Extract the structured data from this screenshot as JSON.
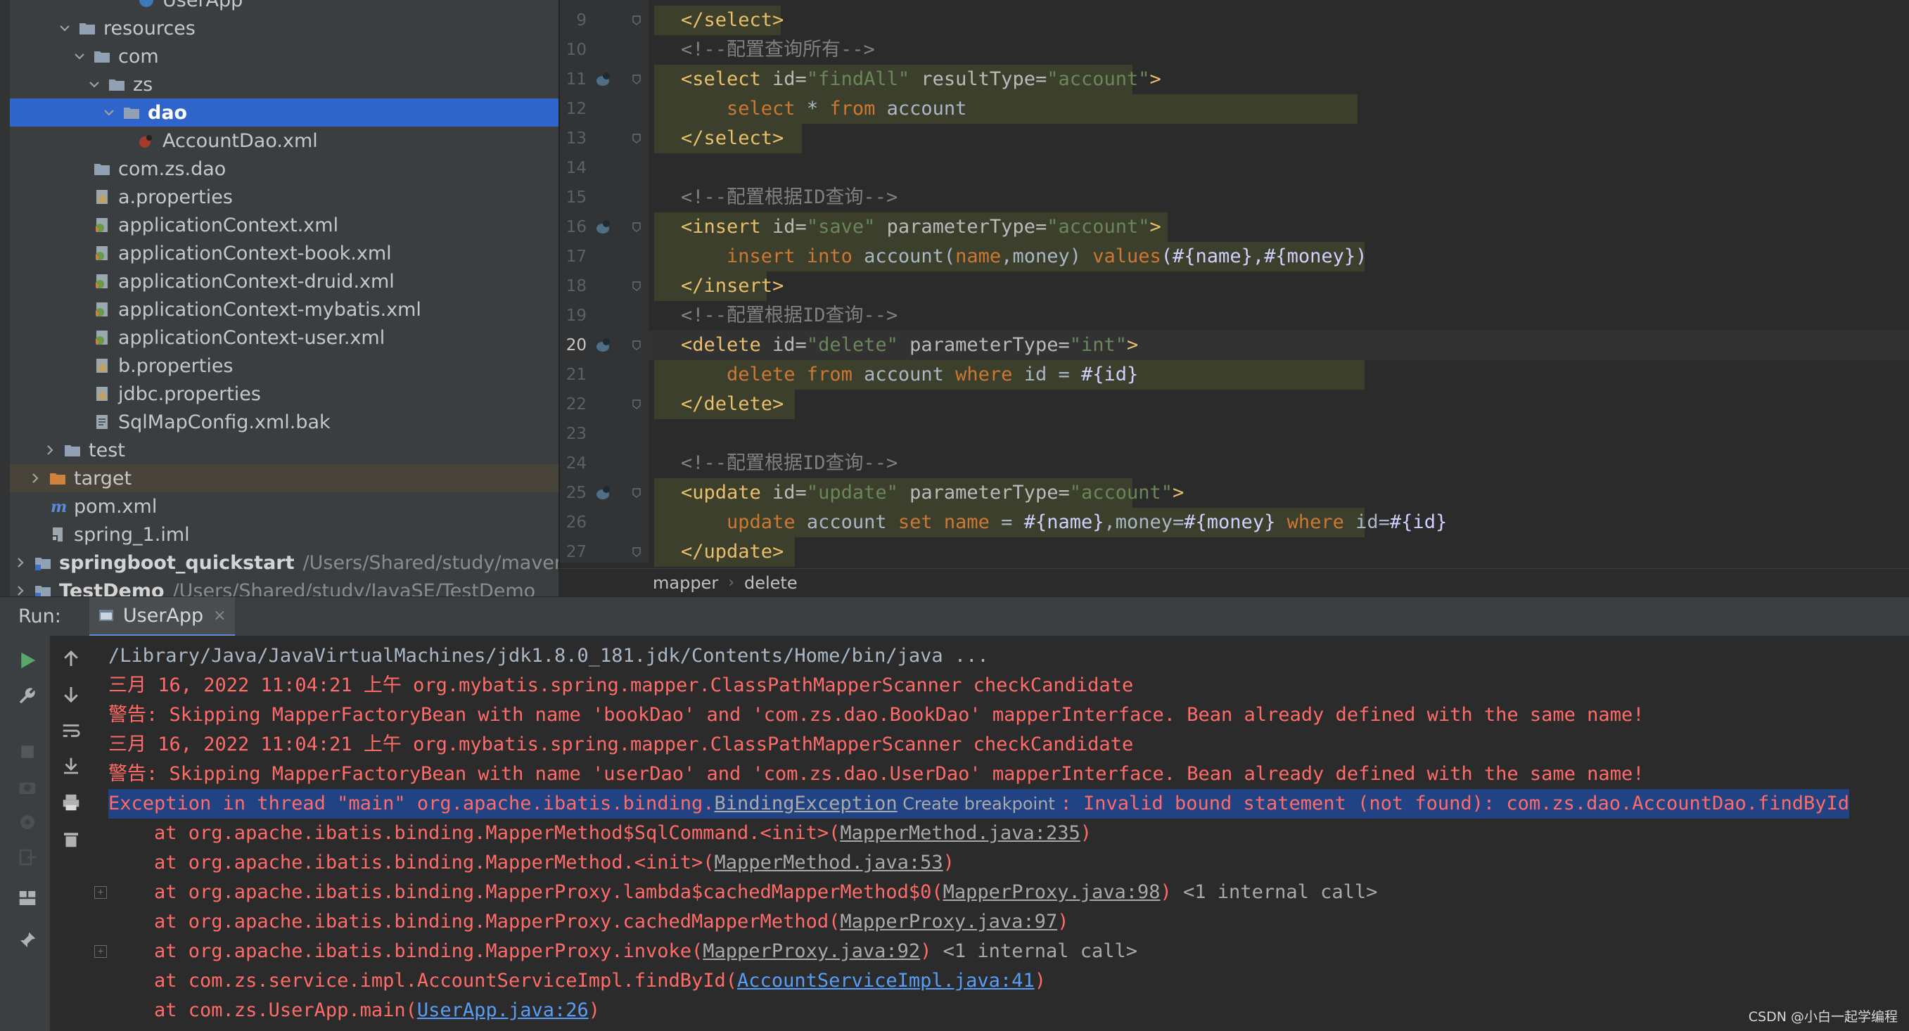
{
  "project_tree": [
    {
      "label": "UserApp",
      "icon": "run-config-icon",
      "level": 7,
      "kind": "partial"
    },
    {
      "label": "resources",
      "icon": "folder-icon",
      "level": 3,
      "expanded": true
    },
    {
      "label": "com",
      "icon": "folder-icon",
      "level": 4,
      "expanded": true
    },
    {
      "label": "zs",
      "icon": "folder-icon",
      "level": 5,
      "expanded": true
    },
    {
      "label": "dao",
      "icon": "folder-icon",
      "level": 6,
      "expanded": true,
      "selected": true
    },
    {
      "label": "AccountDao.xml",
      "icon": "mybatis-xml-icon",
      "level": 7
    },
    {
      "label": "com.zs.dao",
      "icon": "folder-icon",
      "level": 4
    },
    {
      "label": "a.properties",
      "icon": "properties-file-icon",
      "level": 4
    },
    {
      "label": "applicationContext.xml",
      "icon": "spring-xml-icon",
      "level": 4
    },
    {
      "label": "applicationContext-book.xml",
      "icon": "spring-xml-icon",
      "level": 4
    },
    {
      "label": "applicationContext-druid.xml",
      "icon": "spring-xml-icon",
      "level": 4
    },
    {
      "label": "applicationContext-mybatis.xml",
      "icon": "spring-xml-icon",
      "level": 4
    },
    {
      "label": "applicationContext-user.xml",
      "icon": "spring-xml-icon",
      "level": 4
    },
    {
      "label": "b.properties",
      "icon": "properties-file-icon",
      "level": 4
    },
    {
      "label": "jdbc.properties",
      "icon": "properties-file-icon",
      "level": 4
    },
    {
      "label": "SqlMapConfig.xml.bak",
      "icon": "text-file-icon",
      "level": 4
    },
    {
      "label": "test",
      "icon": "folder-icon",
      "level": 2,
      "collapsed": true
    },
    {
      "label": "target",
      "icon": "orange-folder-icon",
      "level": 1,
      "collapsed": true,
      "highlight": true
    },
    {
      "label": "pom.xml",
      "icon": "maven-icon",
      "level": 1
    },
    {
      "label": "spring_1.iml",
      "icon": "iml-file-icon",
      "level": 1
    },
    {
      "label": "springboot_quickstart",
      "path": "/Users/Shared/study/maven/spr",
      "icon": "module-icon",
      "level": 0,
      "collapsed": true,
      "bold": true
    },
    {
      "label": "TestDemo",
      "path": "/Users/Shared/study/JavaSE/TestDemo",
      "icon": "module-icon",
      "level": 0,
      "collapsed": true,
      "bold": true
    }
  ],
  "editor": {
    "line_numbers": [
      "9",
      "10",
      "11",
      "12",
      "13",
      "14",
      "15",
      "16",
      "17",
      "18",
      "19",
      "20",
      "21",
      "22",
      "23",
      "24",
      "25",
      "26",
      "27"
    ],
    "current_line": "20",
    "lines": [
      [
        {
          "t": "</select>",
          "c": "t-tag"
        }
      ],
      [
        {
          "t": "<!--配置查询所有-->",
          "c": "t-cmt"
        }
      ],
      [
        {
          "t": "<select ",
          "c": "t-tag"
        },
        {
          "t": "id=",
          "c": "t-attr"
        },
        {
          "t": "\"findAll\"",
          "c": "t-val"
        },
        {
          "t": " resultType=",
          "c": "t-attr"
        },
        {
          "t": "\"account\"",
          "c": "t-val"
        },
        {
          "t": ">",
          "c": "t-tag"
        }
      ],
      [
        {
          "t": "    select ",
          "c": "t-kw"
        },
        {
          "t": "* ",
          "c": "t-txt"
        },
        {
          "t": "from ",
          "c": "t-kw"
        },
        {
          "t": "account",
          "c": "t-txt"
        }
      ],
      [
        {
          "t": "</select>",
          "c": "t-tag"
        }
      ],
      [],
      [
        {
          "t": "<!--配置根据ID查询-->",
          "c": "t-cmt"
        }
      ],
      [
        {
          "t": "<insert ",
          "c": "t-tag"
        },
        {
          "t": "id=",
          "c": "t-attr"
        },
        {
          "t": "\"save\"",
          "c": "t-val"
        },
        {
          "t": " parameterType=",
          "c": "t-attr"
        },
        {
          "t": "\"account\"",
          "c": "t-val"
        },
        {
          "t": ">",
          "c": "t-tag"
        }
      ],
      [
        {
          "t": "    insert into ",
          "c": "t-kw"
        },
        {
          "t": "account(",
          "c": "t-txt"
        },
        {
          "t": "name",
          "c": "t-kw"
        },
        {
          "t": ",",
          "c": "t-txt"
        },
        {
          "t": "money",
          "c": "t-txt"
        },
        {
          "t": ") ",
          "c": "t-txt"
        },
        {
          "t": "values",
          "c": "t-kw"
        },
        {
          "t": "(#{name},#{money})",
          "c": "t-tpl"
        }
      ],
      [
        {
          "t": "</insert>",
          "c": "t-tag"
        }
      ],
      [
        {
          "t": "<!--配置根据ID查询-->",
          "c": "t-cmt"
        }
      ],
      [
        {
          "t": "<delete ",
          "c": "t-tag"
        },
        {
          "t": "id=",
          "c": "t-attr"
        },
        {
          "t": "\"delete\"",
          "c": "t-val"
        },
        {
          "t": " parameterType=",
          "c": "t-attr"
        },
        {
          "t": "\"int\"",
          "c": "t-val"
        },
        {
          "t": ">",
          "c": "t-tag"
        }
      ],
      [
        {
          "t": "    delete from ",
          "c": "t-kw"
        },
        {
          "t": "account ",
          "c": "t-txt"
        },
        {
          "t": "where ",
          "c": "t-kw"
        },
        {
          "t": "id = ",
          "c": "t-txt"
        },
        {
          "t": "#{id}",
          "c": "t-tpl"
        }
      ],
      [
        {
          "t": "</delete>",
          "c": "t-tag"
        }
      ],
      [],
      [
        {
          "t": "<!--配置根据ID查询-->",
          "c": "t-cmt"
        }
      ],
      [
        {
          "t": "<update ",
          "c": "t-tag"
        },
        {
          "t": "id=",
          "c": "t-attr"
        },
        {
          "t": "\"update\"",
          "c": "t-val"
        },
        {
          "t": " parameterType=",
          "c": "t-attr"
        },
        {
          "t": "\"account\"",
          "c": "t-val"
        },
        {
          "t": ">",
          "c": "t-tag"
        }
      ],
      [
        {
          "t": "    update ",
          "c": "t-kw"
        },
        {
          "t": "account ",
          "c": "t-txt"
        },
        {
          "t": "set ",
          "c": "t-kw"
        },
        {
          "t": "name ",
          "c": "t-kw"
        },
        {
          "t": "= ",
          "c": "t-txt"
        },
        {
          "t": "#{name}",
          "c": "t-tpl"
        },
        {
          "t": ",money=",
          "c": "t-txt"
        },
        {
          "t": "#{money} ",
          "c": "t-tpl"
        },
        {
          "t": "where ",
          "c": "t-kw"
        },
        {
          "t": "id=",
          "c": "t-txt"
        },
        {
          "t": "#{id}",
          "c": "t-tpl"
        }
      ],
      [
        {
          "t": "</update>",
          "c": "t-tag"
        }
      ]
    ],
    "breadcrumb": [
      "mapper",
      "delete"
    ]
  },
  "run": {
    "label": "Run:",
    "tab": "UserApp",
    "close": "×"
  },
  "console": {
    "lines": [
      {
        "kind": "gray",
        "parts": [
          {
            "t": "/Library/Java/JavaVirtualMachines/jdk1.8.0_181.jdk/Contents/Home/bin/java ..."
          }
        ]
      },
      {
        "kind": "err",
        "parts": [
          {
            "t": "三月 16, 2022 11:04:21 上午 org.mybatis.spring.mapper.ClassPathMapperScanner checkCandidate"
          }
        ]
      },
      {
        "kind": "err",
        "parts": [
          {
            "t": "警告: Skipping MapperFactoryBean with name 'bookDao' and 'com.zs.dao.BookDao' mapperInterface. Bean already defined with the same name!"
          }
        ]
      },
      {
        "kind": "err",
        "parts": [
          {
            "t": "三月 16, 2022 11:04:21 上午 org.mybatis.spring.mapper.ClassPathMapperScanner checkCandidate"
          }
        ]
      },
      {
        "kind": "err",
        "parts": [
          {
            "t": "警告: Skipping MapperFactoryBean with name 'userDao' and 'com.zs.dao.UserDao' mapperInterface. Bean already defined with the same name!"
          }
        ]
      },
      {
        "kind": "exc",
        "parts": [
          {
            "t": "Exception in thread \"main\" org.apache.ibatis.binding."
          },
          {
            "t": "BindingException",
            "c": "lk"
          },
          {
            "t": " Create breakpoint ",
            "c": "chip"
          },
          {
            "t": ": Invalid bound statement (not found): com.zs.dao.AccountDao.findById"
          }
        ]
      },
      {
        "kind": "err",
        "parts": [
          {
            "t": "    at org.apache.ibatis.binding.MapperMethod$SqlCommand.<init>("
          },
          {
            "t": "MapperMethod.java:235",
            "c": "lk"
          },
          {
            "t": ")"
          }
        ]
      },
      {
        "kind": "err",
        "parts": [
          {
            "t": "    at org.apache.ibatis.binding.MapperMethod.<init>("
          },
          {
            "t": "MapperMethod.java:53",
            "c": "lk"
          },
          {
            "t": ")"
          }
        ]
      },
      {
        "kind": "err",
        "fold": true,
        "parts": [
          {
            "t": "    at org.apache.ibatis.binding.MapperProxy.lambda$cachedMapperMethod$0("
          },
          {
            "t": "MapperProxy.java:98",
            "c": "lk"
          },
          {
            "t": ") "
          },
          {
            "t": "<1 internal call>",
            "c": "internal"
          }
        ]
      },
      {
        "kind": "err",
        "parts": [
          {
            "t": "    at org.apache.ibatis.binding.MapperProxy.cachedMapperMethod("
          },
          {
            "t": "MapperProxy.java:97",
            "c": "lk"
          },
          {
            "t": ")"
          }
        ]
      },
      {
        "kind": "err",
        "fold": true,
        "parts": [
          {
            "t": "    at org.apache.ibatis.binding.MapperProxy.invoke("
          },
          {
            "t": "MapperProxy.java:92",
            "c": "lk"
          },
          {
            "t": ") "
          },
          {
            "t": "<1 internal call>",
            "c": "internal"
          }
        ]
      },
      {
        "kind": "err",
        "parts": [
          {
            "t": "    at com.zs.service.impl.AccountServiceImpl.findById("
          },
          {
            "t": "AccountServiceImpl.java:41",
            "c": "lkb"
          },
          {
            "t": ")"
          }
        ]
      },
      {
        "kind": "err",
        "parts": [
          {
            "t": "    at com.zs.UserApp.main("
          },
          {
            "t": "UserApp.java:26",
            "c": "lkb"
          },
          {
            "t": ")"
          }
        ]
      }
    ]
  },
  "watermark": "CSDN @小白一起学编程",
  "colors": {
    "selection": "#2f65ca",
    "error_text": "#ff6b68",
    "exception_bg": "#214283",
    "link_blue": "#589df6"
  }
}
